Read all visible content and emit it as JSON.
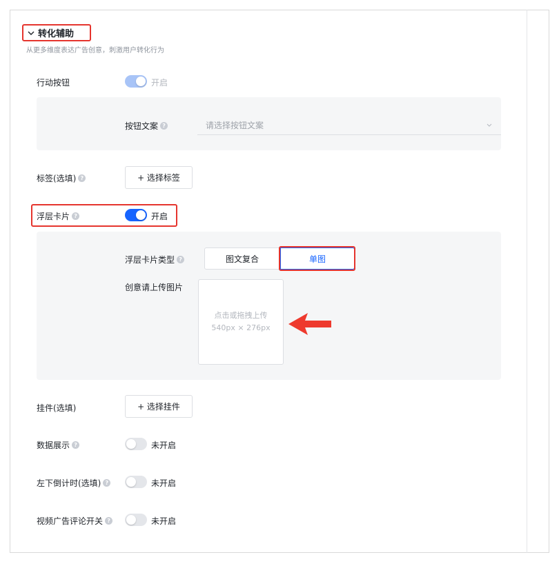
{
  "section": {
    "title": "转化辅助",
    "description": "从更多维度表达广告创意，刺激用户转化行为"
  },
  "action_button": {
    "label": "行动按钮",
    "switch_text": "开启"
  },
  "button_copy": {
    "label": "按钮文案",
    "placeholder": "请选择按钮文案"
  },
  "tags": {
    "label": "标签(选填)",
    "button": "+ 选择标签"
  },
  "float_card": {
    "label": "浮层卡片",
    "switch_text": "开启",
    "type_label": "浮层卡片类型",
    "type_options": [
      "图文复合",
      "单图"
    ],
    "type_selected": "单图",
    "upload_label": "创意请上传图片",
    "upload_hint": "点击或拖拽上传",
    "upload_size": "540px × 276px"
  },
  "widget": {
    "label": "挂件(选填)",
    "button": "+ 选择挂件"
  },
  "data_display": {
    "label": "数据展示",
    "switch_text": "未开启"
  },
  "countdown": {
    "label": "左下倒计时(选填)",
    "switch_text": "未开启"
  },
  "video_comment": {
    "label": "视频广告评论开关",
    "switch_text": "未开启"
  },
  "colors": {
    "primary": "#1664ff",
    "highlight": "#e5342d",
    "subpanel_bg": "#f5f6f7"
  }
}
